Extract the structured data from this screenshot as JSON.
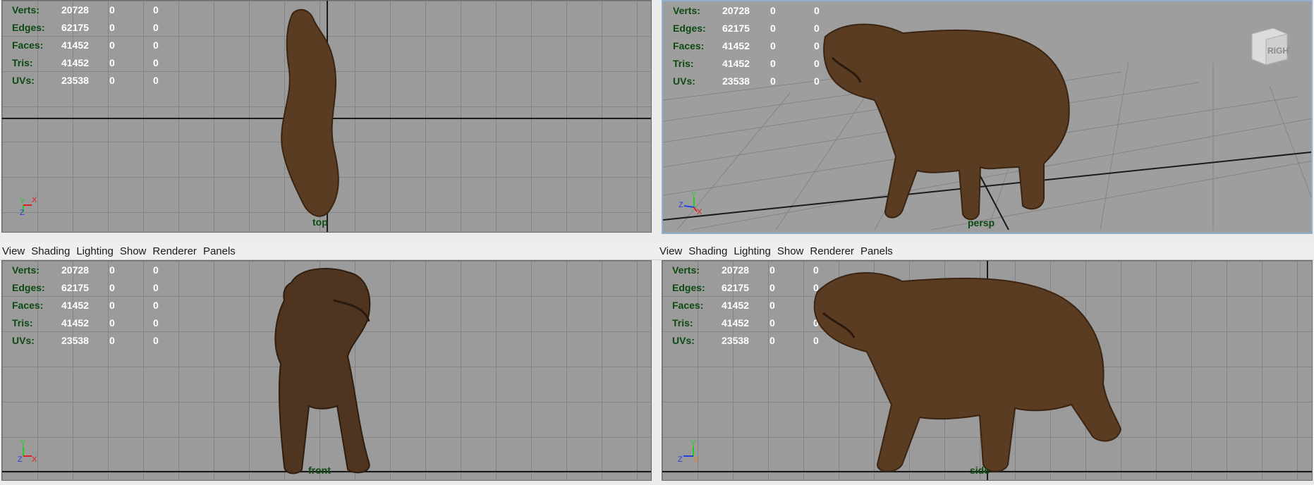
{
  "menu": [
    "View",
    "Shading",
    "Lighting",
    "Show",
    "Renderer",
    "Panels"
  ],
  "hud": {
    "rows": [
      {
        "label": "Verts:",
        "c1": "20728",
        "c2": "0",
        "c3": "0"
      },
      {
        "label": "Edges:",
        "c1": "62175",
        "c2": "0",
        "c3": "0"
      },
      {
        "label": "Faces:",
        "c1": "41452",
        "c2": "0",
        "c3": "0"
      },
      {
        "label": "Tris:",
        "c1": "41452",
        "c2": "0",
        "c3": "0"
      },
      {
        "label": "UVs:",
        "c1": "23538",
        "c2": "0",
        "c3": "0"
      }
    ]
  },
  "panes": {
    "top": {
      "camera": "top"
    },
    "persp": {
      "camera": "persp",
      "viewcube": "RIGHT"
    },
    "front": {
      "camera": "front"
    },
    "side": {
      "camera": "side"
    }
  },
  "axes": {
    "x": "X",
    "y": "Y",
    "z": "Z",
    "x_color": "#e02020",
    "y_color": "#22cc22",
    "z_color": "#2040e0"
  }
}
